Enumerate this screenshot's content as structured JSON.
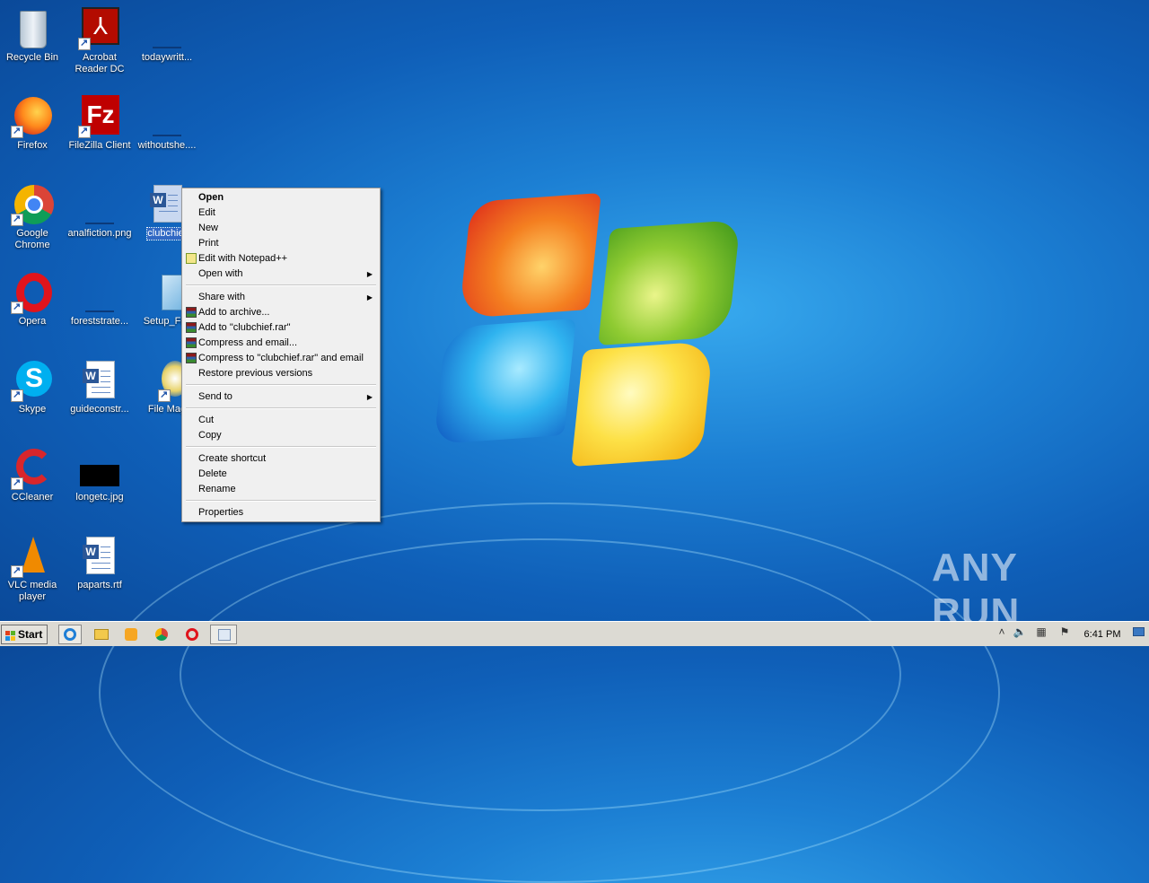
{
  "desktop": {
    "icons": [
      {
        "label": "Recycle Bin"
      },
      {
        "label": "Acrobat Reader DC"
      },
      {
        "label": "todaywritt..."
      },
      {
        "label": "Firefox"
      },
      {
        "label": "FileZilla Client"
      },
      {
        "label": "withoutshe...."
      },
      {
        "label": "Google Chrome"
      },
      {
        "label": "analfiction.png"
      },
      {
        "label": "clubchief"
      },
      {
        "label": "Opera"
      },
      {
        "label": "foreststrate..."
      },
      {
        "label": "Setup_File"
      },
      {
        "label": "Skype"
      },
      {
        "label": "guideconstr..."
      },
      {
        "label": "File Mag"
      },
      {
        "label": "CCleaner"
      },
      {
        "label": "longetc.jpg"
      },
      {
        "label": "VLC media player"
      },
      {
        "label": "paparts.rtf"
      }
    ]
  },
  "context_menu": {
    "items": [
      {
        "label": "Open"
      },
      {
        "label": "Edit"
      },
      {
        "label": "New"
      },
      {
        "label": "Print"
      },
      {
        "label": "Edit with Notepad++"
      },
      {
        "label": "Open with"
      },
      {
        "label": "Share with"
      },
      {
        "label": "Add to archive..."
      },
      {
        "label": "Add to \"clubchief.rar\""
      },
      {
        "label": "Compress and email..."
      },
      {
        "label": "Compress to \"clubchief.rar\" and email"
      },
      {
        "label": "Restore previous versions"
      },
      {
        "label": "Send to"
      },
      {
        "label": "Cut"
      },
      {
        "label": "Copy"
      },
      {
        "label": "Create shortcut"
      },
      {
        "label": "Delete"
      },
      {
        "label": "Rename"
      },
      {
        "label": "Properties"
      }
    ]
  },
  "taskbar": {
    "start_label": "Start",
    "clock": "6:41 PM"
  },
  "watermark": "ANY RUN"
}
